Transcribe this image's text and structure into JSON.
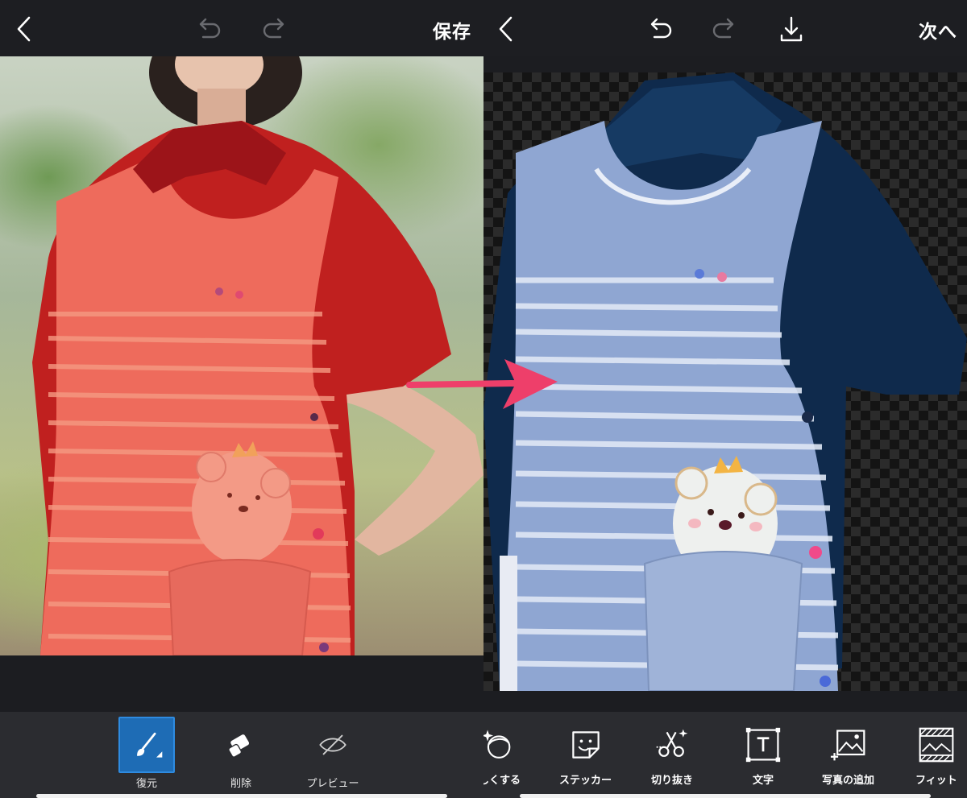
{
  "left": {
    "topbar": {
      "save_label": "保存"
    },
    "tools": [
      {
        "label": "復元",
        "icon": "brush-icon"
      },
      {
        "label": "削除",
        "icon": "eraser-icon"
      },
      {
        "label": "プレビュー",
        "icon": "preview-hidden-icon"
      }
    ],
    "selected_tool": "復元"
  },
  "right": {
    "topbar": {
      "next_label": "次へ"
    },
    "tools": [
      {
        "label": "しくする",
        "icon": "face-sparkle-icon"
      },
      {
        "label": "ステッカー",
        "icon": "sticker-icon"
      },
      {
        "label": "切り抜き",
        "icon": "scissors-icon"
      },
      {
        "label": "文字",
        "icon": "text-icon"
      },
      {
        "label": "写真の追加",
        "icon": "add-photo-icon"
      },
      {
        "label": "フィット",
        "icon": "fit-icon"
      }
    ]
  },
  "colors": {
    "accent": "#1e6cb5",
    "mask_overlay": "#e8504e",
    "arrow": "#ee3f6a",
    "toolbar_bg": "#2b2c30",
    "topbar_bg": "#1d1e22"
  }
}
